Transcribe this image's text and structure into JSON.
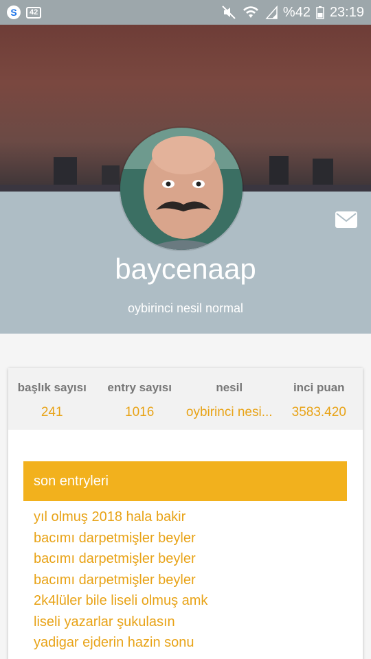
{
  "statusbar": {
    "notification_badge": "42",
    "battery": "%42",
    "time": "23:19"
  },
  "profile": {
    "username": "baycenaap",
    "generation_label": "oybirinci nesil normal"
  },
  "stats": [
    {
      "label": "başlık sayısı",
      "value": "241"
    },
    {
      "label": "entry sayısı",
      "value": "1016"
    },
    {
      "label": "nesil",
      "value": "oybirinci nesi..."
    },
    {
      "label": "inci puan",
      "value": "3583.420"
    }
  ],
  "entries": {
    "title": "son entryleri",
    "items": [
      "yıl olmuş 2018 hala bakir",
      "bacımı darpetmişler beyler",
      "bacımı darpetmişler beyler",
      "bacımı darpetmişler beyler",
      "2k4lüler bile liseli olmuş amk",
      "liseli yazarlar şukulasın",
      "yadigar ejderin hazin sonu"
    ]
  },
  "colors": {
    "accent": "#f2b11d",
    "accent_text": "#e8a317",
    "header_band": "#aebdc5"
  }
}
